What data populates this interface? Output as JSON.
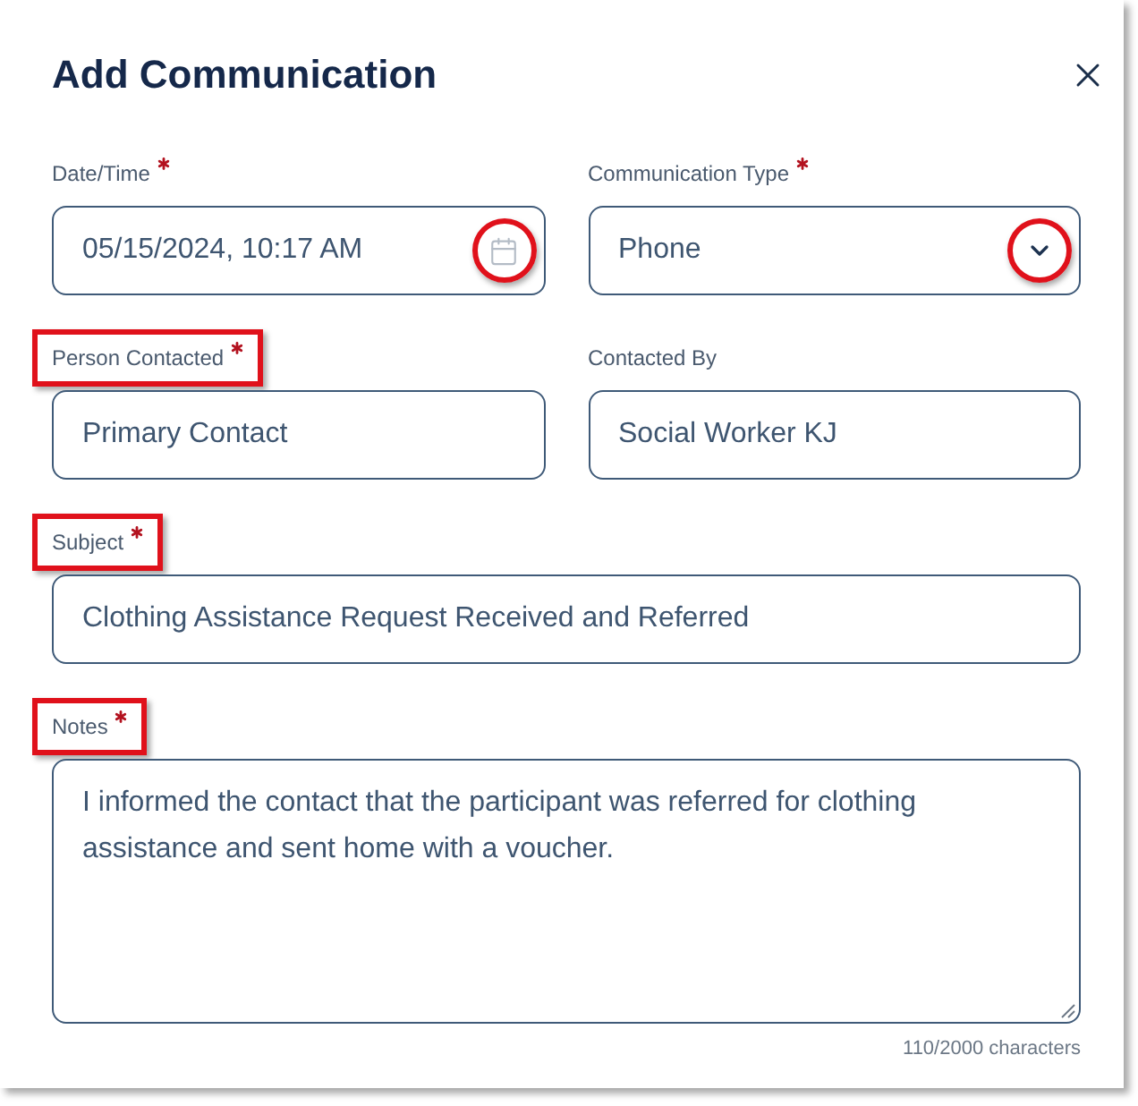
{
  "dialog": {
    "title": "Add Communication"
  },
  "rows": [
    {
      "fields": [
        {
          "kind": "datetime",
          "label": "Date/Time",
          "required": true,
          "label_boxed": false,
          "value": "05/15/2024, 10:17 AM",
          "icon_circled": true
        },
        {
          "kind": "select",
          "label": "Communication Type",
          "required": true,
          "label_boxed": false,
          "value": "Phone",
          "icon_circled": true
        }
      ]
    },
    {
      "fields": [
        {
          "kind": "text",
          "label": "Person Contacted",
          "required": true,
          "label_boxed": true,
          "value": "Primary Contact"
        },
        {
          "kind": "text",
          "label": "Contacted By",
          "required": false,
          "label_boxed": false,
          "value": "Social Worker KJ"
        }
      ]
    },
    {
      "fields": [
        {
          "kind": "text",
          "label": "Subject",
          "required": true,
          "label_boxed": true,
          "value": "Clothing Assistance Request Received and Referred"
        }
      ]
    },
    {
      "fields": [
        {
          "kind": "textarea",
          "label": "Notes",
          "required": true,
          "label_boxed": true,
          "value": "I informed the contact that the participant was referred for clothing assistance and sent home with a voucher."
        }
      ]
    }
  ],
  "character_count": "110/2000 characters"
}
